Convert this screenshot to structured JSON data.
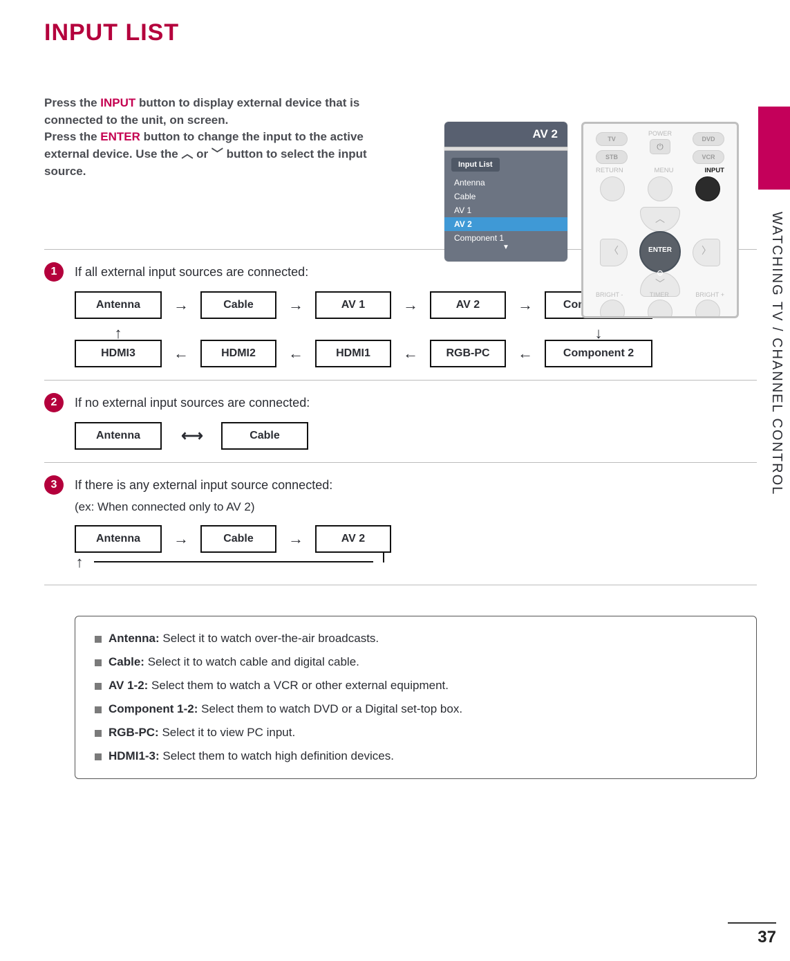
{
  "title": "INPUT LIST",
  "intro": {
    "t1a": "Press the ",
    "t1h": "INPUT",
    "t1b": " button to display external device that is connected to the unit, on screen.",
    "t2a": "Press the ",
    "t2h": "ENTER",
    "t2b": " button to change the input to the active external device. Use the ",
    "t2c": " or ",
    "t2d": " button to select the input source."
  },
  "osd": {
    "header": "AV 2",
    "tab": "Input List",
    "items": [
      "Antenna",
      "Cable",
      "AV 1",
      "AV 2",
      "Component 1"
    ],
    "selected": "AV 2"
  },
  "remote": {
    "pills": {
      "tv": "TV",
      "dvd": "DVD",
      "stb": "STB",
      "vcr": "VCR"
    },
    "power_label": "POWER",
    "top_labels": {
      "return": "RETURN",
      "menu": "MENU",
      "input": "INPUT"
    },
    "enter": "ENTER",
    "bottom_labels": {
      "bm": "BRIGHT -",
      "tm": "TIMER",
      "bp": "BRIGHT +"
    }
  },
  "side_text": "WATCHING TV / CHANNEL CONTROL",
  "sec1": {
    "n": "1",
    "title": "If all external input sources are connected:",
    "row1": [
      "Antenna",
      "Cable",
      "AV 1",
      "AV 2",
      "Component 1"
    ],
    "row2": [
      "HDMI3",
      "HDMI2",
      "HDMI1",
      "RGB-PC",
      "Component 2"
    ]
  },
  "sec2": {
    "n": "2",
    "title": "If no external input sources are connected:",
    "row": [
      "Antenna",
      "Cable"
    ]
  },
  "sec3": {
    "n": "3",
    "title": "If there is any external input source connected:",
    "sub": "(ex: When connected only to AV 2)",
    "row": [
      "Antenna",
      "Cable",
      "AV 2"
    ]
  },
  "info": {
    "items": [
      {
        "k": "Antenna:",
        "v": " Select it to watch over-the-air broadcasts."
      },
      {
        "k": "Cable:",
        "v": " Select it to watch cable and digital cable."
      },
      {
        "k": "AV 1-2:",
        "v": " Select them to watch a VCR or other external equipment."
      },
      {
        "k": "Component 1-2:",
        "v": " Select them to watch DVD or a Digital set-top box."
      },
      {
        "k": "RGB-PC:",
        "v": " Select it to view PC input."
      },
      {
        "k": "HDMI1-3:",
        "v": " Select them to watch high definition devices."
      }
    ]
  },
  "pagenum": "37"
}
